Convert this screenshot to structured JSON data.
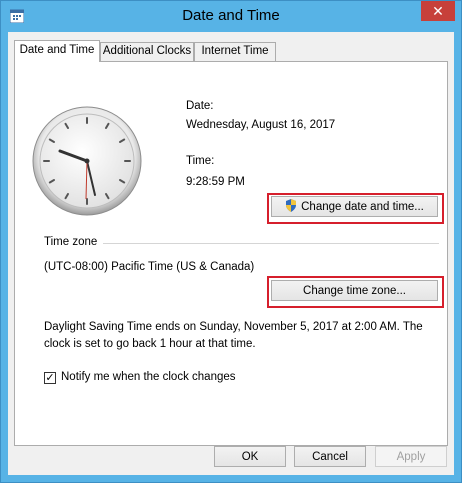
{
  "window": {
    "title": "Date and Time",
    "close_glyph": "✕"
  },
  "tabs": [
    {
      "label": "Date and Time",
      "active": true
    },
    {
      "label": "Additional Clocks",
      "active": false
    },
    {
      "label": "Internet Time",
      "active": false
    }
  ],
  "date": {
    "label": "Date:",
    "value": "Wednesday, August 16, 2017"
  },
  "time": {
    "label": "Time:",
    "value": "9:28:59 PM"
  },
  "change_datetime_button": "Change date and time...",
  "timezone": {
    "section_label": "Time zone",
    "value": "(UTC-08:00) Pacific Time (US & Canada)",
    "change_button": "Change time zone..."
  },
  "dst_notice": {
    "line1": "Daylight Saving Time ends on Sunday, November 5, 2017 at 2:00 AM. The",
    "line2": "clock is set to go back 1 hour at that time."
  },
  "notify_checkbox": {
    "label": "Notify me when the clock changes",
    "checked": true,
    "glyph": "✓"
  },
  "footer_buttons": {
    "ok": "OK",
    "cancel": "Cancel",
    "apply": "Apply"
  },
  "colors": {
    "window_frame": "#57b3e6",
    "close_button": "#c7403a",
    "highlight_box": "#d61f2c",
    "disabled_text": "#a0a0a0"
  }
}
